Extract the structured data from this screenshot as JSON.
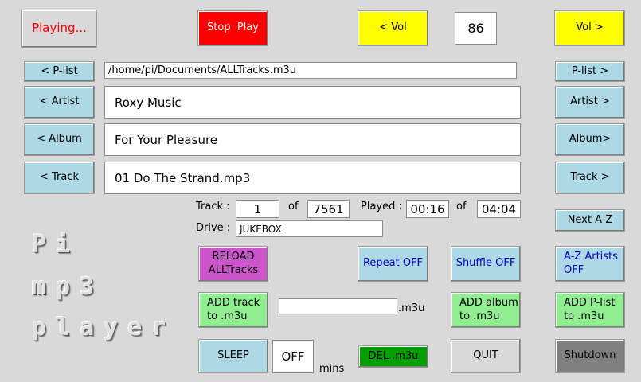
{
  "top": {
    "status": "Playing...",
    "stop_play": "Stop  Play",
    "vol_down": "< Vol",
    "volume": "86",
    "vol_up": "Vol >"
  },
  "nav": {
    "plist_prev": "< P-list",
    "plist_next": "P-list >",
    "artist_prev": "< Artist",
    "artist_next": "Artist >",
    "album_prev": "< Album",
    "album_next": "Album>",
    "track_prev": "< Track",
    "track_next": "Track >",
    "next_az": "Next A-Z"
  },
  "now": {
    "playlist_path": "/home/pi/Documents/ALLTracks.m3u",
    "artist": "Roxy Music",
    "album": "For Your Pleasure",
    "track": "01 Do The Strand.mp3"
  },
  "info": {
    "track_label": "Track :",
    "track_num": "1",
    "of1": "of",
    "track_total": "7561",
    "played_label": "Played :",
    "played_time": "00:16",
    "of2": "of",
    "total_time": "04:04",
    "drive_label": "Drive :",
    "drive": "JUKEBOX"
  },
  "logo": {
    "line1": "Pi",
    "line2": "mp3",
    "line3": "player"
  },
  "actions": {
    "reload": "RELOAD ALLTracks",
    "repeat": "Repeat OFF",
    "shuffle": "Shuffle OFF",
    "az_artists": "A-Z Artists OFF",
    "add_track": "ADD track to .m3u",
    "m3u_name": "",
    "m3u_suffix": ".m3u",
    "add_album": "ADD album to .m3u",
    "add_plist": "ADD P-list to .m3u",
    "sleep": "SLEEP",
    "sleep_value": "OFF",
    "mins": "mins",
    "del_m3u": "DEL .m3u",
    "quit": "QUIT",
    "shutdown": "Shutdown"
  }
}
